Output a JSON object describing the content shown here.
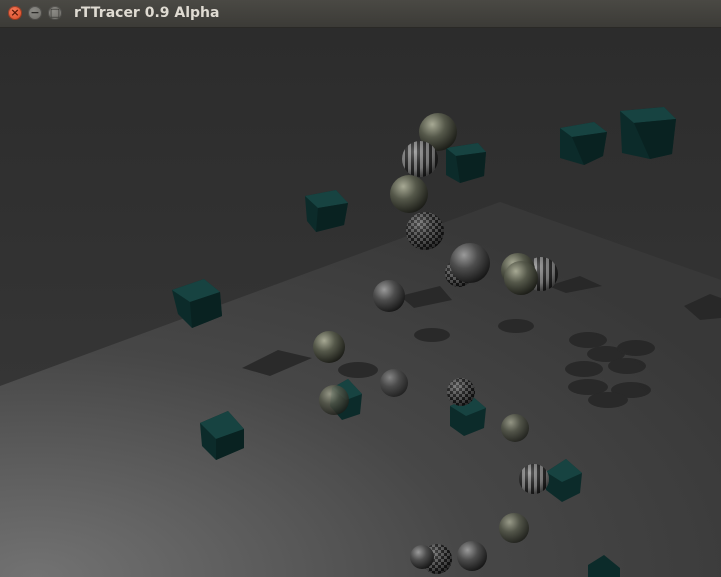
{
  "window": {
    "title": "rTTracer 0.9 Alpha",
    "controls": {
      "close": "×",
      "minimize": "−",
      "maximize": "□"
    }
  },
  "scene": {
    "description_visible": false,
    "colors": {
      "background_top": "#2e2e2e",
      "background_bottom": "#3c3c3c",
      "floor_near": "#6e6e6e",
      "floor_far": "#3a3a3a",
      "cube_face": "#0d2f2e",
      "cube_top": "#173f3d",
      "shadow": "#262626"
    },
    "object_counts": {
      "spheres": 18,
      "cubes": 11
    }
  }
}
